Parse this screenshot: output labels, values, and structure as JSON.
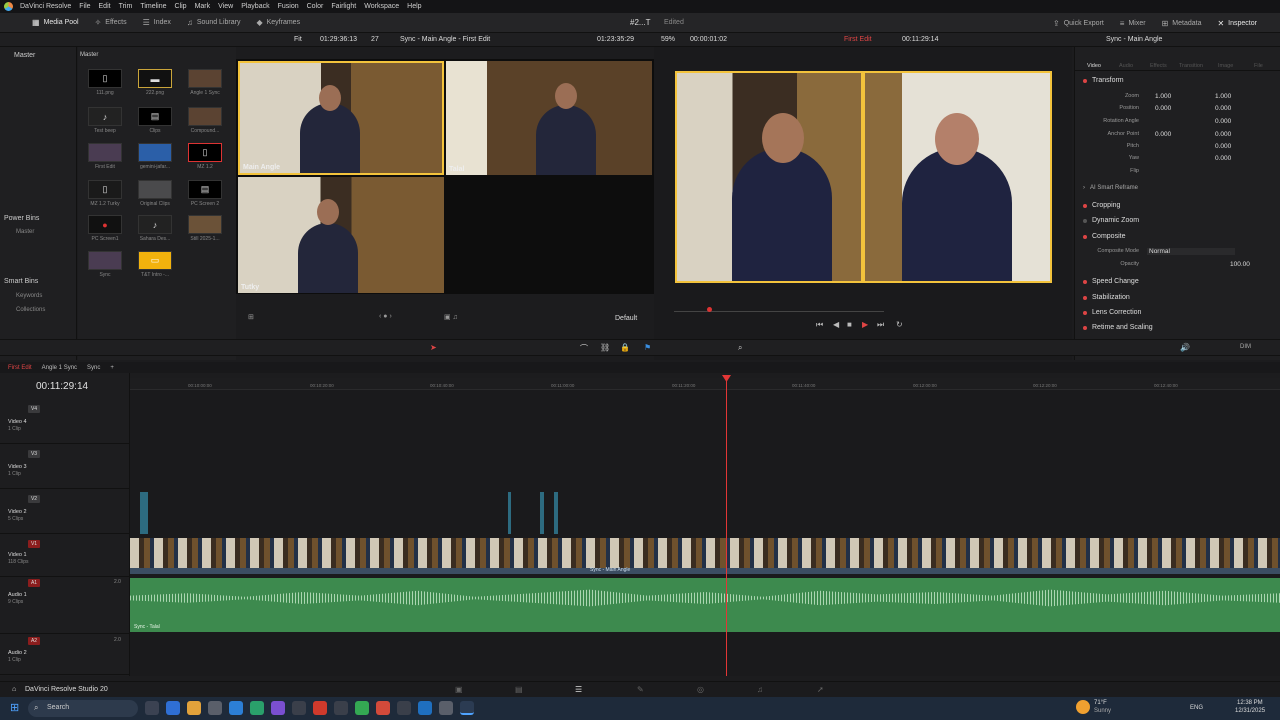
{
  "menu": [
    "DaVinci Resolve",
    "File",
    "Edit",
    "Trim",
    "Timeline",
    "Clip",
    "Mark",
    "View",
    "Playback",
    "Fusion",
    "Color",
    "Fairlight",
    "Workspace",
    "Help"
  ],
  "toolbar": {
    "media_pool": "Media Pool",
    "effects": "Effects",
    "index": "Index",
    "sound_library": "Sound Library",
    "keyframes": "Keyframes",
    "project": "#2...T",
    "status": "Edited",
    "quick_export": "Quick Export",
    "mixer": "Mixer",
    "metadata": "Metadata",
    "inspector": "Inspector"
  },
  "subbar": {
    "fit": "Fit",
    "source_tc": "01:29:36:13",
    "frames": "27",
    "title": "Sync - Main Angle - First Edit",
    "duration_tc": "01:23:35:29",
    "zoom": "59%",
    "dur2": "00:00:01:02",
    "timeline_name": "First Edit",
    "program_tc": "00:11:29:14",
    "inspector_title": "Sync - Main Angle"
  },
  "left_panel": {
    "master": "Master",
    "power_bins": "Power Bins",
    "power_master": "Master",
    "smart_bins": "Smart Bins",
    "keywords": "Keywords",
    "collections": "Collections"
  },
  "media_pool": {
    "header": "Master",
    "clips": [
      {
        "name": "111.png"
      },
      {
        "name": "222.png"
      },
      {
        "name": "Angle 1 Sync"
      },
      {
        "name": "Test beep"
      },
      {
        "name": "Clips"
      },
      {
        "name": "Compound..."
      },
      {
        "name": "First Edit"
      },
      {
        "name": "gemini-jafar..."
      },
      {
        "name": "MZ 1.2"
      },
      {
        "name": "MZ 1.2 Turky"
      },
      {
        "name": "Original Clips"
      },
      {
        "name": "PC Screen 2"
      },
      {
        "name": "PC Screen1"
      },
      {
        "name": "Sahara Des..."
      },
      {
        "name": "Still 2025-1..."
      },
      {
        "name": "Sync"
      },
      {
        "name": "T&T Intro -..."
      }
    ]
  },
  "multiview": {
    "angle1": "Main Angle",
    "angle2": "Talal",
    "angle3": "Tutky"
  },
  "viewer": {
    "default": "Default"
  },
  "inspector": {
    "tabs": [
      "Video",
      "Audio",
      "Effects",
      "Transition",
      "Image",
      "File"
    ],
    "transform": "Transform",
    "zoom_label": "Zoom",
    "zoom_x": "1.000",
    "zoom_y": "1.000",
    "position_label": "Position",
    "pos_x": "0.000",
    "pos_y": "0.000",
    "rotation_label": "Rotation Angle",
    "rotation": "0.000",
    "anchor_label": "Anchor Point",
    "anchor_x": "0.000",
    "anchor_y": "0.000",
    "pitch_label": "Pitch",
    "pitch": "0.000",
    "yaw_label": "Yaw",
    "yaw": "0.000",
    "flip_label": "Flip",
    "smart_reframe": "AI Smart Reframe",
    "cropping": "Cropping",
    "dynamic_zoom": "Dynamic Zoom",
    "composite": "Composite",
    "composite_mode_label": "Composite Mode",
    "composite_mode": "Normal",
    "opacity_label": "Opacity",
    "opacity": "100.00",
    "speed_change": "Speed Change",
    "stabilization": "Stabilization",
    "lens_correction": "Lens Correction",
    "retime": "Retime and Scaling"
  },
  "timeline": {
    "tabs": [
      "First Edit",
      "Angle 1 Sync",
      "Sync"
    ],
    "timecode": "00:11:29:14",
    "ruler": [
      "00:10:00:00",
      "00:10:20:00",
      "00:10:40:00",
      "00:11:00:00",
      "00:11:20:00",
      "00:11:40:00",
      "00:12:00:00",
      "00:12:20:00",
      "00:12:40:00"
    ],
    "tracks": [
      {
        "badge": "V4",
        "name": "Video 4",
        "sub": "1 Clip"
      },
      {
        "badge": "V3",
        "name": "Video 3",
        "sub": "1 Clip"
      },
      {
        "badge": "V2",
        "name": "Video 2",
        "sub": "5 Clips"
      },
      {
        "badge": "V1",
        "name": "Video 1",
        "sub": "118 Clips"
      },
      {
        "badge": "A1",
        "name": "Audio 1",
        "sub": "9 Clips"
      },
      {
        "badge": "A2",
        "name": "Audio 2",
        "sub": "1 Clip"
      }
    ],
    "audio_level_a1": "2.0",
    "audio_level_a2": "2.0",
    "clip_label_v1": "Sync - Main Angle",
    "audio_clip_label": "Sync - Talal",
    "dim": "DIM"
  },
  "pagebar": {
    "app": "DaVinci Resolve Studio 20"
  },
  "taskbar": {
    "search": "Search",
    "weather_temp": "71°F",
    "weather_desc": "Sunny",
    "lang": "ENG",
    "time": "12:38 PM",
    "date": "12/31/2025"
  }
}
